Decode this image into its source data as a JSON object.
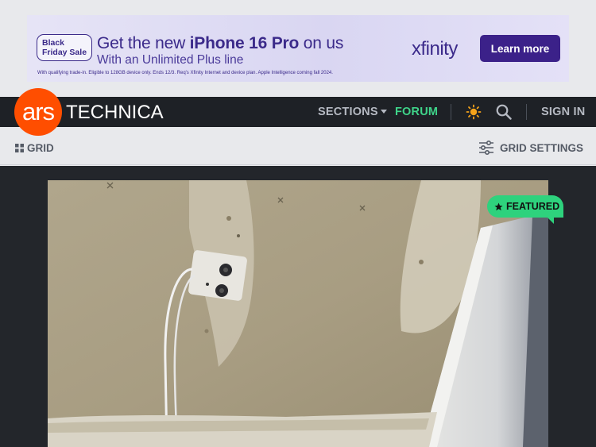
{
  "ad": {
    "badge_line1": "Black",
    "badge_line2": "Friday Sale",
    "headline_pre": "Get the new ",
    "headline_bold": "iPhone 16 Pro",
    "headline_post": " on us",
    "subline": "With an Unlimited Plus line",
    "fine_print": "With qualifying trade-in. Eligible to 128GB device only. Ends 12/3. Req's Xfinity Internet and device plan. Apple Intelligence coming fall 2024.",
    "brand": "xfinity",
    "cta": "Learn more",
    "colors": {
      "brand": "#3b2189",
      "background": "#dcd9f3"
    }
  },
  "header": {
    "logo_mark": "ars",
    "logo_text": "TECHNICA",
    "nav": {
      "sections": "SECTIONS",
      "forum": "FORUM",
      "sign_in": "SIGN IN"
    },
    "icons": [
      "sun-icon",
      "search-icon"
    ],
    "colors": {
      "logo": "#ff4e00",
      "forum": "#3fd58a",
      "bar": "#1e2126"
    }
  },
  "subbar": {
    "grid_label": "GRID",
    "grid_settings_label": "GRID SETTINGS"
  },
  "feature": {
    "badge": "FEATURED",
    "badge_color": "#2ed27d"
  }
}
